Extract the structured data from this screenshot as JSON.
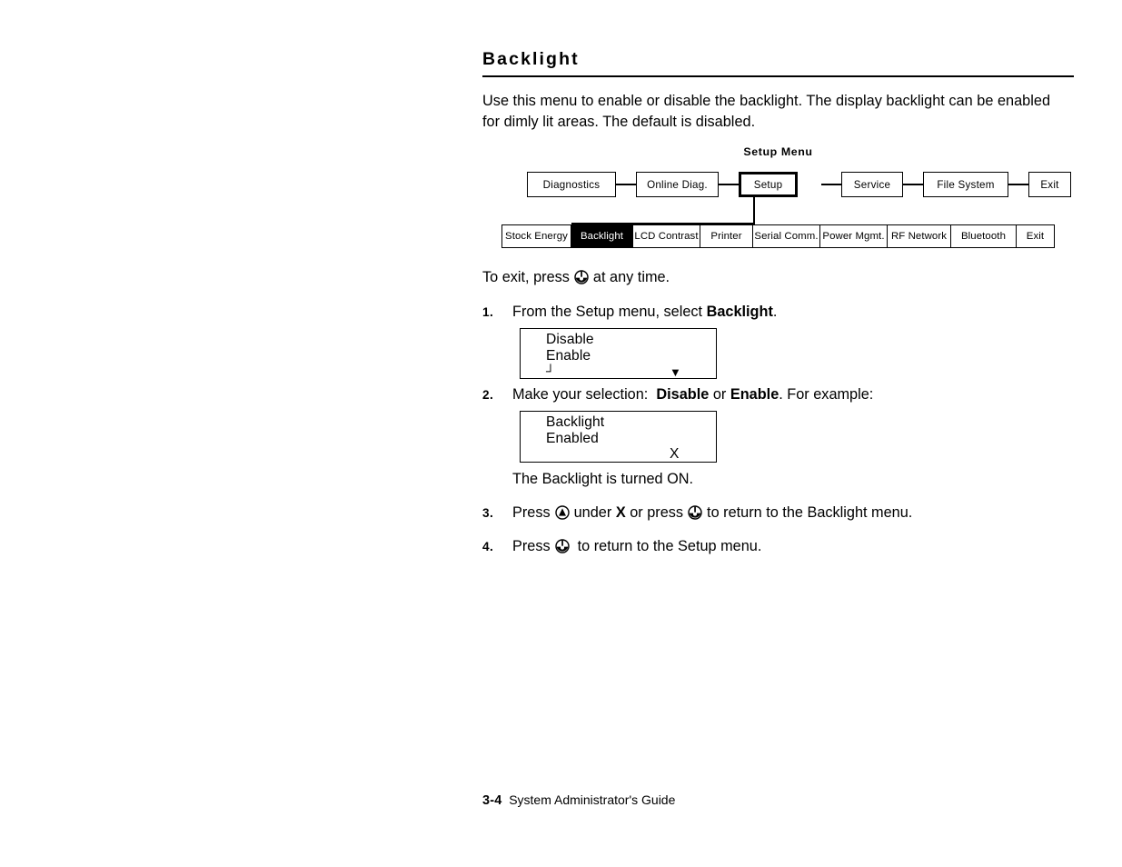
{
  "heading": "Backlight",
  "intro": "Use this menu to enable or disable the backlight.  The display backlight can be enabled for dimly lit areas.  The default is disabled.",
  "diagram": {
    "title": "Setup Menu",
    "top_row": [
      {
        "label": "Diagnostics",
        "selected": false
      },
      {
        "label": "Online Diag.",
        "selected": false
      },
      {
        "label": "Setup",
        "selected": true
      },
      {
        "label": "Service",
        "selected": false
      },
      {
        "label": "File System",
        "selected": false
      },
      {
        "label": "Exit",
        "selected": false
      }
    ],
    "bottom_row": [
      {
        "label": "Stock Energy",
        "highlighted": false
      },
      {
        "label": "Backlight",
        "highlighted": true
      },
      {
        "label": "LCD Contrast",
        "highlighted": false
      },
      {
        "label": "Printer",
        "highlighted": false
      },
      {
        "label": "Serial Comm.",
        "highlighted": false
      },
      {
        "label": "Power Mgmt.",
        "highlighted": false
      },
      {
        "label": "RF Network",
        "highlighted": false
      },
      {
        "label": "Bluetooth",
        "highlighted": false
      },
      {
        "label": "Exit",
        "highlighted": false
      }
    ]
  },
  "exit_note": {
    "before": "To exit, press",
    "icon": "escape-key-icon",
    "after": "at any time."
  },
  "steps": [
    {
      "number": "1.",
      "text_before": "From the Setup menu, select",
      "bold": "Backlight",
      "text_after": "."
    },
    {
      "number": "2.",
      "text_before": "Make your selection:",
      "bold": "Disable",
      "text_mid": "or",
      "bold2": "Enable",
      "text_after": ".  For example:"
    },
    {
      "number": "3.",
      "text_before": "Press",
      "icon1": "circled-up-arrow-icon",
      "text_mid": "under",
      "bold": "X",
      "text_mid2": "or press",
      "icon2": "escape-key-icon",
      "text_after": "to return to the Backlight menu."
    },
    {
      "number": "4.",
      "text_before": "Press",
      "icon1": "escape-key-icon",
      "text_after": "to return to the Setup menu."
    }
  ],
  "lcd1": {
    "line1": "Disable",
    "line2": "Enable",
    "enter_symbol": "┘",
    "down_symbol": "▼"
  },
  "lcd2": {
    "line1": "Backlight",
    "line2": "Enabled",
    "line3": "X"
  },
  "caption_after_lcd2": "The Backlight is turned ON.",
  "footer": {
    "page_number": "3-4",
    "title": "System Administrator's Guide"
  }
}
